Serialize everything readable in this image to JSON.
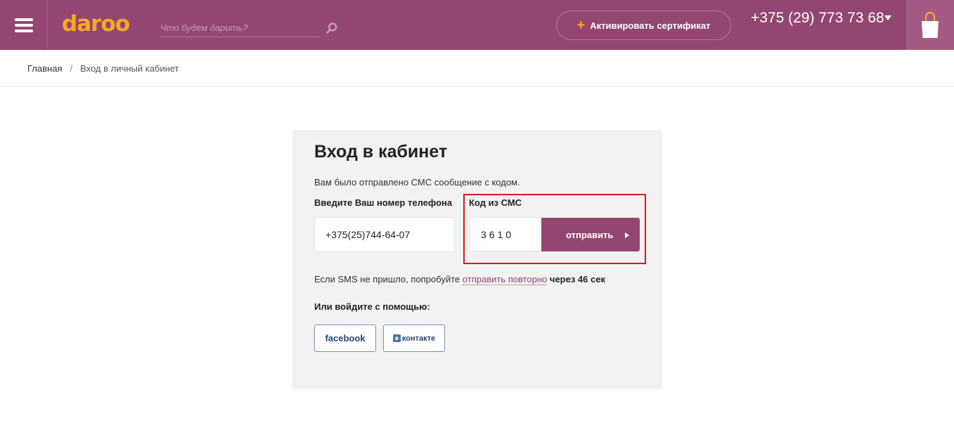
{
  "header": {
    "logo": "daroo",
    "search_placeholder": "Что будем дарить?",
    "certificate_label": "Активировать сертификат",
    "phone": "+375 (29) 773 73 68",
    "accent_color": "#944673",
    "logo_color": "#f7a823"
  },
  "breadcrumb": {
    "home": "Главная",
    "separator": "/",
    "current": "Вход в личный кабинет"
  },
  "login": {
    "title": "Вход в кабинет",
    "sms_note": "Вам было отправлено СМС сообщение с кодом.",
    "phone_label": "Введите Ваш номер телефона",
    "phone_value": "+375(25)744-64-07",
    "code_label": "Код из СМС",
    "code_value": "3610",
    "send_label": "отправить",
    "resend_prefix": "Если SMS не пришло, попробуйте",
    "resend_link": "отправить повторно",
    "resend_timer": "через 46 сек",
    "social_label": "Или войдите с помощью:",
    "facebook_label": "facebook",
    "vk_label": "контакте",
    "vk_logo": "в"
  },
  "icons": {
    "menu": "menu-icon",
    "search": "search-icon",
    "plus": "plus-icon",
    "caret": "caret-down-icon",
    "cart": "shopping-bag-icon",
    "send_arrow": "arrow-right-icon"
  }
}
